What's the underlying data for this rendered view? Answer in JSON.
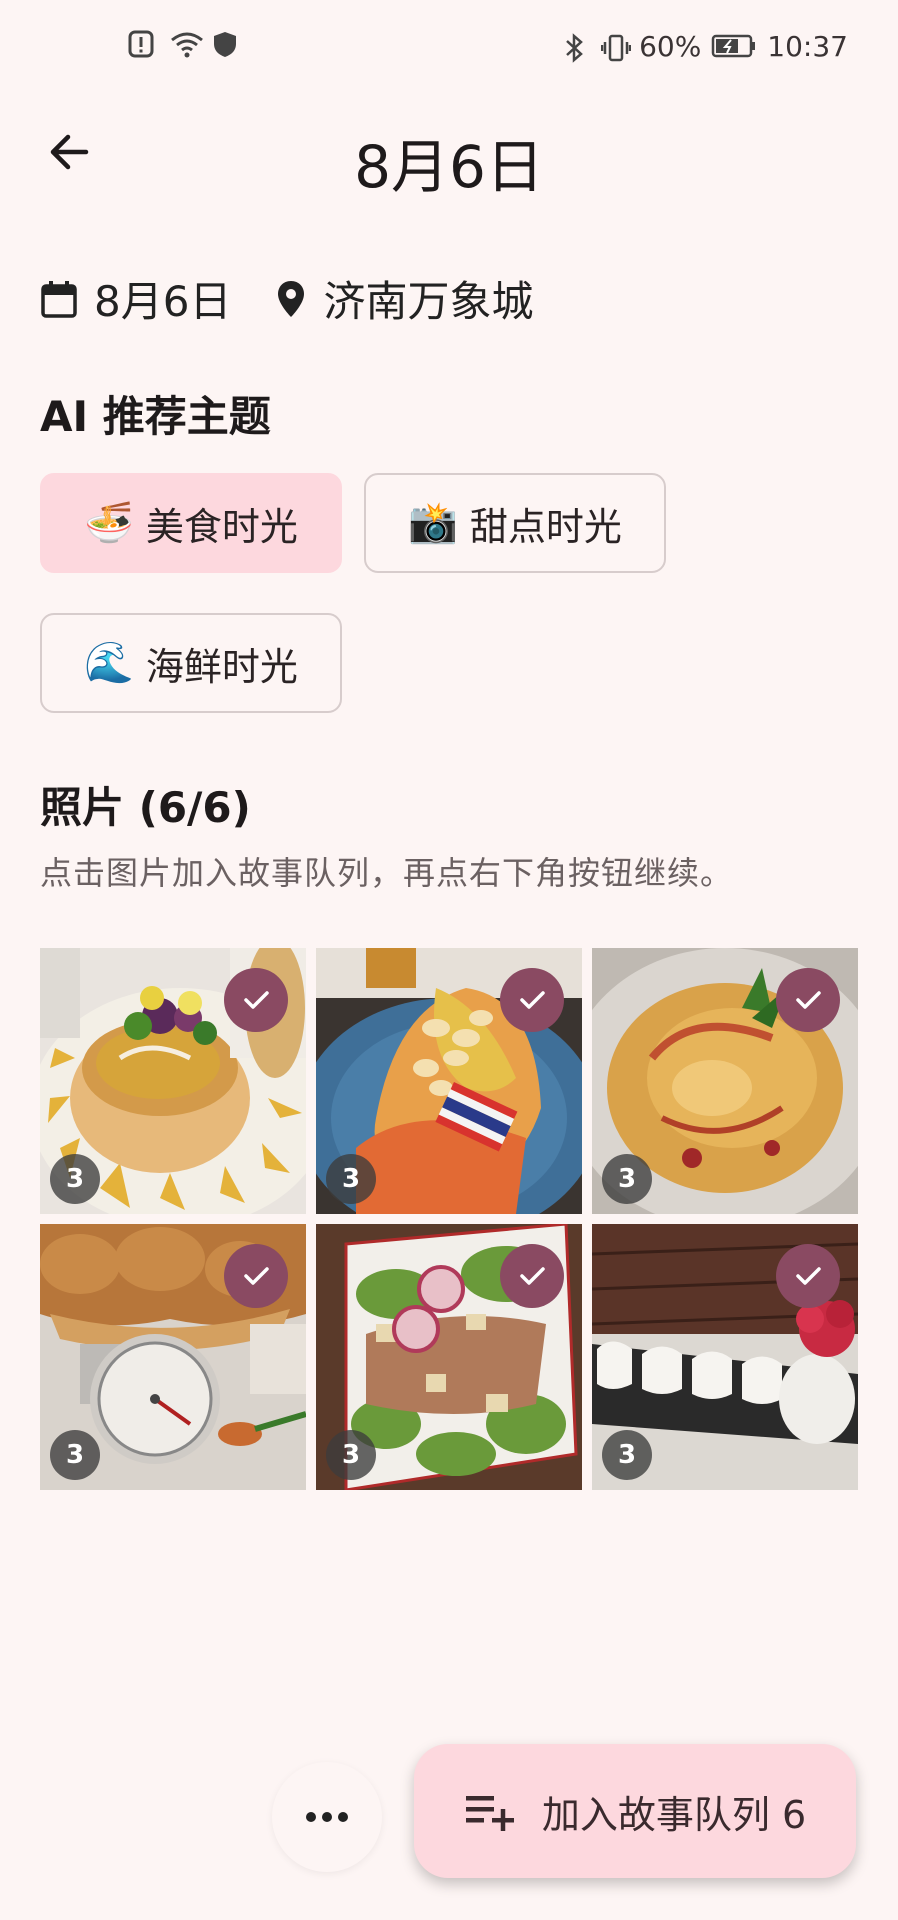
{
  "status_bar": {
    "battery": "60%",
    "time": "10:37"
  },
  "header": {
    "title": "8月6日"
  },
  "meta": {
    "date": "8月6日",
    "location": "济南万象城"
  },
  "ai_section": {
    "title": "AI 推荐主题",
    "chips": [
      {
        "emoji": "🍜",
        "label": "美食时光",
        "selected": true
      },
      {
        "emoji": "📸",
        "label": "甜点时光",
        "selected": false
      },
      {
        "emoji": "🌊",
        "label": "海鲜时光",
        "selected": false
      }
    ]
  },
  "photos_section": {
    "title": "照片 (6/6)",
    "hint": "点击图片加入故事队列，再点右下角按钮继续。",
    "photos": [
      {
        "count": "3"
      },
      {
        "count": "3"
      },
      {
        "count": "3"
      },
      {
        "count": "3"
      },
      {
        "count": "3"
      },
      {
        "count": "3"
      }
    ]
  },
  "actions": {
    "add_queue_label": "加入故事队列 6"
  }
}
